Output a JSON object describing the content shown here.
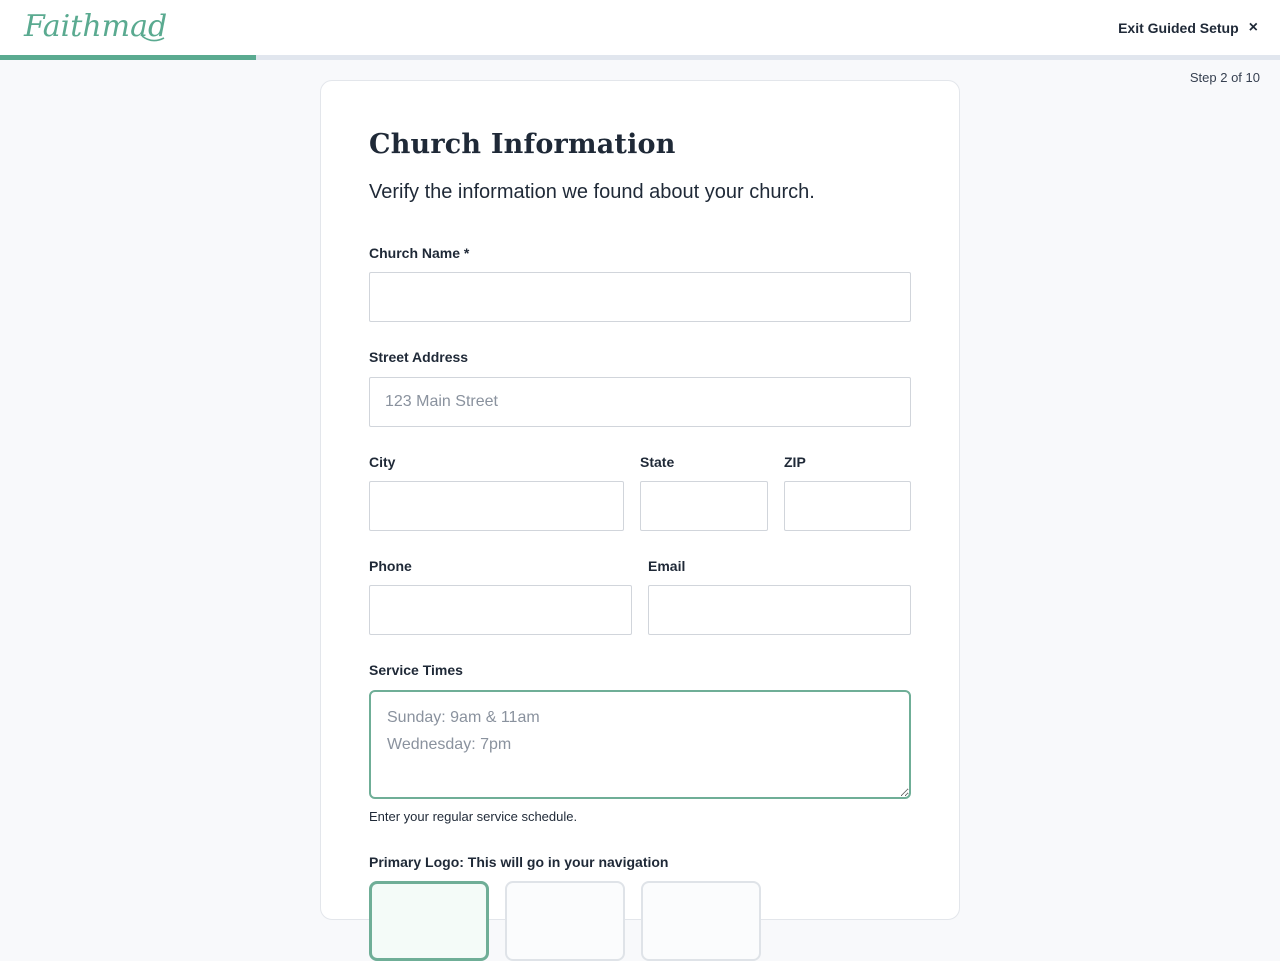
{
  "header": {
    "brand": "Faithmade",
    "exit_label": "Exit Guided Setup",
    "exit_icon": "close-icon",
    "brand_color": "#5aaa90"
  },
  "progress": {
    "step_text": "Step 2 of 10",
    "fraction": 0.2
  },
  "form": {
    "title": "Church Information",
    "subtitle": "Verify the information we found about your church.",
    "church_name": {
      "label": "Church Name *",
      "value": "",
      "placeholder": ""
    },
    "street": {
      "label": "Street Address",
      "value": "",
      "placeholder": "123 Main Street"
    },
    "city": {
      "label": "City",
      "value": ""
    },
    "state": {
      "label": "State",
      "value": ""
    },
    "zip": {
      "label": "ZIP",
      "value": ""
    },
    "phone": {
      "label": "Phone",
      "value": ""
    },
    "email": {
      "label": "Email",
      "value": ""
    },
    "service_times": {
      "label": "Service Times",
      "placeholder": "Sunday: 9am & 11am\nWednesday: 7pm",
      "help": "Enter your regular service schedule."
    },
    "primary_logo": {
      "label": "Primary Logo: This will go in your navigation",
      "selected_option": 1
    }
  }
}
